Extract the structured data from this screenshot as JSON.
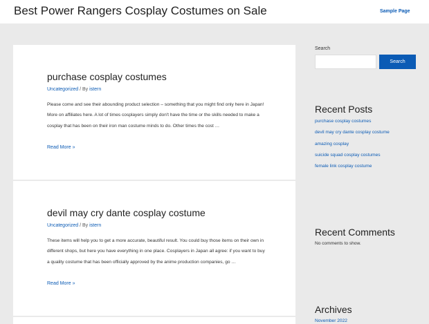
{
  "header": {
    "site_title": "Best Power Rangers Cosplay Costumes on Sale",
    "nav_link": "Sample Page"
  },
  "posts": [
    {
      "title": "purchase cosplay costumes",
      "category": "Uncategorized",
      "meta_sep": " / By ",
      "author": "istern",
      "excerpt": "Please come and see their abounding product selection – something that you might find only here in Japan! More on affiliates here. A lot of times cosplayers simply don't have the time or the skills needed to make a cosplay that has been on their iron man costume minds to do. Other times the cost …",
      "read_more": "Read More »"
    },
    {
      "title": "devil may cry dante cosplay costume",
      "category": "Uncategorized",
      "meta_sep": " / By ",
      "author": "istern",
      "excerpt": "These items will help you to get a more accurate, beautiful result. You could buy those items on their own in different shops, but here you have everything in one place. Cosplayers in Japan all agree: if you want to buy a quality costume that has been officially approved by the anime production companies, go …",
      "read_more": "Read More »"
    }
  ],
  "sidebar": {
    "search_label": "Search",
    "search_value": "",
    "search_button": "Search",
    "recent_posts_title": "Recent Posts",
    "recent_posts": [
      "purchase cosplay costumes",
      "devil may cry dante cosplay costume",
      "amazing cosplay",
      "suicide squad cosplay costumes",
      "female link cosplay costume"
    ],
    "recent_comments_title": "Recent Comments",
    "no_comments": "No comments to show.",
    "archives_title": "Archives",
    "archive_item": "November 2022"
  },
  "colors": {
    "accent": "#0b5bb5",
    "background": "#eaeaea"
  }
}
